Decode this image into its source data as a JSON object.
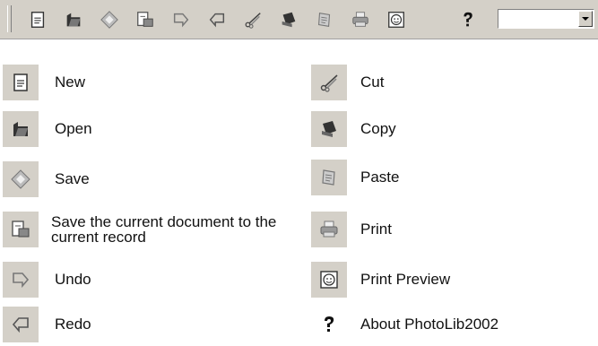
{
  "toolbar": {
    "buttons": [
      {
        "name": "new",
        "icon": "new-document-icon"
      },
      {
        "name": "open",
        "icon": "open-folder-icon"
      },
      {
        "name": "save",
        "icon": "save-icon"
      },
      {
        "name": "save-to-record",
        "icon": "save-to-record-icon"
      },
      {
        "name": "undo",
        "icon": "undo-icon"
      },
      {
        "name": "redo",
        "icon": "redo-icon"
      },
      {
        "name": "cut",
        "icon": "scissors-icon"
      },
      {
        "name": "copy",
        "icon": "copy-icon"
      },
      {
        "name": "paste",
        "icon": "paste-icon"
      },
      {
        "name": "print",
        "icon": "printer-icon"
      },
      {
        "name": "print-preview",
        "icon": "print-preview-icon"
      },
      {
        "name": "about",
        "icon": "question-icon"
      }
    ],
    "combo_value": ""
  },
  "legend": {
    "left": [
      {
        "label": "New",
        "icon": "new-document-icon"
      },
      {
        "label": "Open",
        "icon": "open-folder-icon"
      },
      {
        "label": "Save",
        "icon": "save-icon"
      },
      {
        "label": "Save the current document to the current record",
        "icon": "save-to-record-icon"
      },
      {
        "label": "Undo",
        "icon": "undo-icon"
      },
      {
        "label": "Redo",
        "icon": "redo-icon"
      }
    ],
    "right": [
      {
        "label": "Cut",
        "icon": "scissors-icon"
      },
      {
        "label": "Copy",
        "icon": "copy-icon"
      },
      {
        "label": "Paste",
        "icon": "paste-icon"
      },
      {
        "label": "Print",
        "icon": "printer-icon"
      },
      {
        "label": "Print Preview",
        "icon": "print-preview-icon"
      },
      {
        "label": "About PhotoLib2002",
        "icon": "question-icon"
      }
    ]
  },
  "colors": {
    "toolbar_bg": "#d4d0c8",
    "icon_gray": "#8a8a8a",
    "icon_dark": "#202020"
  }
}
